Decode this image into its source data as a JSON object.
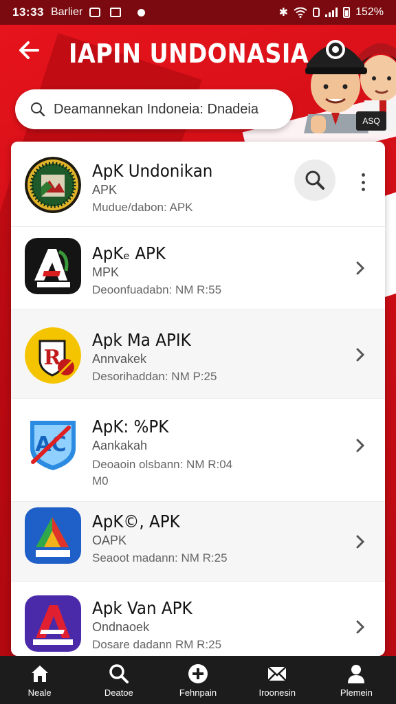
{
  "status_bar": {
    "time": "13:33",
    "carrier": "Barlier",
    "battery": "152%"
  },
  "header": {
    "title": "IAPIN UNDONASIA",
    "badge": "ASQ"
  },
  "search": {
    "placeholder": "Deamannekan Indoneia: Dnadeia"
  },
  "apps": [
    {
      "name": "ApK Undonikan",
      "sub": "APK",
      "meta": "Mudue/dabon: APK",
      "icon": "emblem-green-icon"
    },
    {
      "name": "ApKₑ APK",
      "sub": "MPK",
      "meta": "Deoonfuadabn: NM R:55",
      "icon": "black-a-icon"
    },
    {
      "name": "Apk Ma APIK",
      "sub": "Annvakek",
      "meta": "Desorihaddan: NM P:25",
      "icon": "yellow-shield-icon"
    },
    {
      "name": "ApK: %PK",
      "sub": "Aankakah",
      "meta": "Deoaoin olsbann: NM R:04 M0",
      "icon": "blue-shield-icon"
    },
    {
      "name": "ApK©, APK",
      "sub": "OAPK",
      "meta": "Seaoot madann: NM R:25",
      "icon": "green-a-icon"
    },
    {
      "name": "Apk Van APK",
      "sub": "Ondnaoek",
      "meta": "Dosare dadann RM R:25",
      "icon": "purple-a-icon"
    }
  ],
  "nav": [
    {
      "label": "Neale",
      "icon": "home-icon"
    },
    {
      "label": "Deatoe",
      "icon": "search-icon"
    },
    {
      "label": "Fehnpain",
      "icon": "plus-circle-icon"
    },
    {
      "label": "Iroonesin",
      "icon": "mail-icon"
    },
    {
      "label": "Plemein",
      "icon": "person-icon"
    }
  ],
  "colors": {
    "brand_red": "#d8101a",
    "status_bar": "#7a0a0f",
    "bottom_nav": "#1c1c1c"
  }
}
